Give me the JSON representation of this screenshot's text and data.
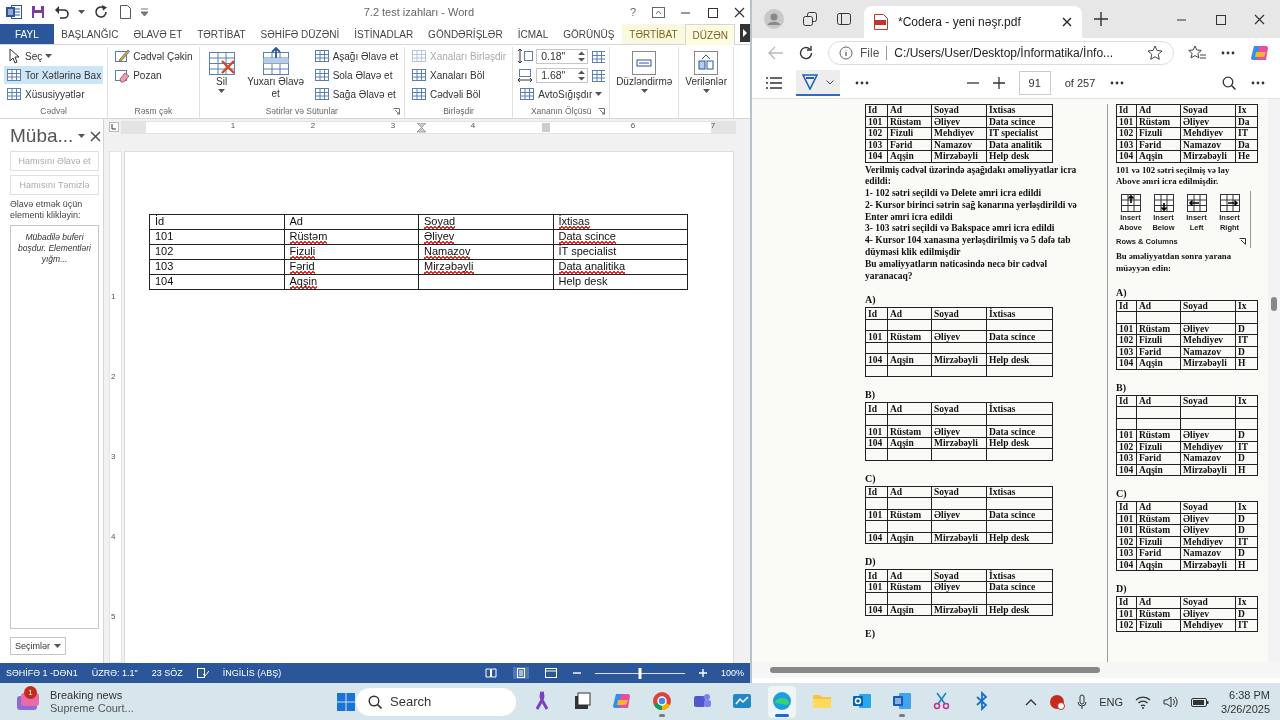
{
  "word": {
    "title": "7.2 test izahları - Word",
    "help": "?",
    "tabs": [
      {
        "label": "FAYL",
        "kind": "file",
        "selected": false
      },
      {
        "label": "BAŞLANĞIC",
        "kind": "normal",
        "selected": false
      },
      {
        "label": "ƏLAVƏ ET",
        "kind": "normal",
        "selected": false
      },
      {
        "label": "TƏRTİBAT",
        "kind": "normal",
        "selected": false
      },
      {
        "label": "SƏHİFƏ DÜZƏNİ",
        "kind": "normal",
        "selected": false
      },
      {
        "label": "İSTİNADLAR",
        "kind": "normal",
        "selected": false
      },
      {
        "label": "GÖNDƏRİŞLƏR",
        "kind": "normal",
        "selected": false
      },
      {
        "label": "İCMAL",
        "kind": "normal",
        "selected": false
      },
      {
        "label": "GÖRÜNÜŞ",
        "kind": "normal",
        "selected": false
      },
      {
        "label": "TƏRTİBAT",
        "kind": "context",
        "selected": false
      },
      {
        "label": "DÜZƏN",
        "kind": "context",
        "selected": true
      }
    ],
    "ribbon_groups": [
      {
        "label": "Cədvəl",
        "launcher": false,
        "items": [
          {
            "kind": "small",
            "label": "Seç",
            "dropdown": true,
            "on": false,
            "disabled": false
          },
          {
            "kind": "small",
            "label": "Tor Xətlərinə Bax",
            "dropdown": false,
            "on": true,
            "disabled": false
          },
          {
            "kind": "small",
            "label": "Xüsusiyyətlər",
            "dropdown": false,
            "on": false,
            "disabled": false
          }
        ]
      },
      {
        "label": "Rəsm çək",
        "launcher": false,
        "items": [
          {
            "kind": "small",
            "label": "Cədvəl Çəkin",
            "dropdown": false,
            "on": false,
            "disabled": false
          },
          {
            "kind": "small",
            "label": "Pozan",
            "dropdown": false,
            "on": false,
            "disabled": false
          }
        ]
      },
      {
        "label": "Sətirlər və Sütunlar",
        "launcher": true,
        "items": [
          {
            "kind": "large",
            "label": "Sil",
            "dropdown": true,
            "on": false,
            "disabled": false
          },
          {
            "kind": "large",
            "label": "Yuxarı Əlavə et",
            "dropdown": false,
            "on": false,
            "disabled": false
          },
          {
            "kind": "small",
            "label": "Aşağı Əlavə et",
            "dropdown": false,
            "on": false,
            "disabled": false
          },
          {
            "kind": "small",
            "label": "Sola Əlavə et",
            "dropdown": false,
            "on": false,
            "disabled": false
          },
          {
            "kind": "small",
            "label": "Sağa Əlavə et",
            "dropdown": false,
            "on": false,
            "disabled": false
          }
        ]
      },
      {
        "label": "Birləşdir",
        "launcher": false,
        "items": [
          {
            "kind": "small",
            "label": "Xanaları Birləşdir",
            "dropdown": false,
            "on": false,
            "disabled": true
          },
          {
            "kind": "small",
            "label": "Xanaları Böl",
            "dropdown": false,
            "on": false,
            "disabled": false
          },
          {
            "kind": "small",
            "label": "Cədvəli Böl",
            "dropdown": false,
            "on": false,
            "disabled": false
          }
        ]
      },
      {
        "label": "Xananın Ölçüsü",
        "launcher": true,
        "items": [
          {
            "kind": "spinner",
            "value": "0.18\""
          },
          {
            "kind": "spinner",
            "value": "1.68\""
          },
          {
            "kind": "small",
            "label": "AvtoSığışdır",
            "dropdown": true,
            "on": false,
            "disabled": false
          }
        ]
      },
      {
        "items": [
          {
            "kind": "large",
            "label": "Düzləndirmə",
            "dropdown": true,
            "on": false,
            "disabled": false
          }
        ]
      },
      {
        "items": [
          {
            "kind": "large",
            "label": "Verilənlər",
            "dropdown": true,
            "on": false,
            "disabled": false
          }
        ]
      }
    ],
    "clipboard_pane": {
      "title": "Müba...",
      "buttons": [
        {
          "label": "Hamısını Əlavə et",
          "disabled": true
        },
        {
          "label": "Hamısını Təmizlə",
          "disabled": true
        }
      ],
      "hint": "Əlavə etmək üçün elementi klikləyin:",
      "empty_message": "Mübadilə buferi boşdur. Elementləri yığm...",
      "options_button": "Seçimlər"
    },
    "ruler": {
      "numbers": [
        "1",
        "2",
        "3",
        "4",
        "6",
        "7"
      ]
    },
    "vertical_ruler": {
      "numbers": [
        "1",
        "2",
        "3",
        "4",
        "5"
      ]
    },
    "document_table": {
      "columns": [
        {
          "text": "İd",
          "misspelled": false
        },
        {
          "text": "Ad",
          "misspelled": false
        },
        {
          "text": "Soyad",
          "misspelled": true
        },
        {
          "text": "İxtisas",
          "misspelled": true
        }
      ],
      "rows": [
        {
          "cells": [
            {
              "text": "101",
              "misspelled": false
            },
            {
              "text": "Rüstəm",
              "misspelled": true
            },
            {
              "text": "Əliyev",
              "misspelled": true
            },
            {
              "text": "Data scince",
              "misspelled": true
            }
          ]
        },
        {
          "cells": [
            {
              "text": "102",
              "misspelled": false
            },
            {
              "text": "Fizuli",
              "misspelled": true
            },
            {
              "text": "Namazov",
              "misspelled": true
            },
            {
              "text": "İT specialist",
              "misspelled": false
            }
          ]
        },
        {
          "cells": [
            {
              "text": "103",
              "misspelled": false
            },
            {
              "text": "Fərid",
              "misspelled": true
            },
            {
              "text": "Mirzəbəyli",
              "misspelled": true
            },
            {
              "text": "Data analitika",
              "misspelled": true
            }
          ]
        },
        {
          "cells": [
            {
              "text": "104",
              "misspelled": false
            },
            {
              "text": "Aqşin",
              "misspelled": true
            },
            {
              "misspelled": false
            },
            {
              "text": "Help desk",
              "misspelled": false
            }
          ]
        }
      ]
    },
    "status_bar": {
      "page": "SƏHİFƏ 1 -DƏN1",
      "position": "ÜZRƏ: 1.1\"",
      "words": "23 SÖZ",
      "language": "İNGİLİS (ABŞ)",
      "zoom": "100%",
      "zoom_slider": {
        "level": 0.5
      }
    }
  },
  "edge": {
    "tabs": [
      {
        "title": "*Codera - yeni nəşr.pdf",
        "selected": true
      }
    ],
    "address": {
      "scheme": "File",
      "url": "C:/Users/User/Desktop/İnformatika/İnfo..."
    },
    "pdf_toolbar": {
      "draw_selected": true,
      "page": "91",
      "page_total": "of 257"
    },
    "pdf_page": {
      "columns": [
        {
          "blocks": [
            {
              "kind": "table",
              "rows": [
                {
                  "kind": "data",
                  "cells": [
                    "Id",
                    "Ad",
                    "Soyad",
                    "İxtisas"
                  ]
                },
                {
                  "kind": "data",
                  "cells": [
                    "101",
                    "Rüstəm",
                    "Əliyev",
                    "Data scince"
                  ]
                },
                {
                  "kind": "data",
                  "cells": [
                    "102",
                    "Fizuli",
                    "Mehdiyev",
                    "IT specialist"
                  ]
                },
                {
                  "kind": "data",
                  "cells": [
                    "103",
                    "Fərid",
                    "Namazov",
                    "Data analitik"
                  ]
                },
                {
                  "kind": "data",
                  "cells": [
                    "104",
                    "Aqşin",
                    "Mirzəbəyli",
                    "Help desk"
                  ]
                }
              ]
            },
            {
              "kind": "text",
              "lines": [
                "Verilmiş cədvəl üzərində aşağıdakı əməliyyatlar icra",
                "edildi:",
                "1- 102 sətri seçildi və Delete əmri icra edildi",
                "2- Kursor birinci sətrin sağ kənarına yerləşdirildi və",
                "Enter əmri icra edildi",
                "3- 103 sətri seçildi və Bakspace əmri icra edildi",
                "4- Kursor 104 xanasına yerləşdirilmiş və 5 dəfə tab",
                "düyməsi klik edilmişdir",
                "Bu əməliyyatların nəticəsində necə bir cədvəl",
                "yaranacaq?"
              ]
            },
            {
              "kind": "label",
              "text": "A)"
            },
            {
              "kind": "table",
              "rows": [
                {
                  "kind": "data",
                  "cells": [
                    "Id",
                    "Ad",
                    "Soyad",
                    "İxtisas"
                  ]
                },
                {
                  "kind": "empty"
                },
                {
                  "kind": "data",
                  "cells": [
                    "101",
                    "Rüstəm",
                    "Əliyev",
                    "Data scince"
                  ]
                },
                {
                  "kind": "empty"
                },
                {
                  "kind": "data",
                  "cells": [
                    "104",
                    "Aqşin",
                    "Mirzəbəyli",
                    "Help desk"
                  ]
                },
                {
                  "kind": "empty"
                }
              ]
            },
            {
              "kind": "label",
              "text": "B)"
            },
            {
              "kind": "table",
              "rows": [
                {
                  "kind": "data",
                  "cells": [
                    "Id",
                    "Ad",
                    "Soyad",
                    "İxtisas"
                  ]
                },
                {
                  "kind": "empty"
                },
                {
                  "kind": "data",
                  "cells": [
                    "101",
                    "Rüstəm",
                    "Əliyev",
                    "Data scince"
                  ]
                },
                {
                  "kind": "data",
                  "cells": [
                    "104",
                    "Aqşin",
                    "Mirzəbəyli",
                    "Help desk"
                  ]
                },
                {
                  "kind": "empty"
                }
              ]
            },
            {
              "kind": "label",
              "text": "C)"
            },
            {
              "kind": "table",
              "rows": [
                {
                  "kind": "data",
                  "cells": [
                    "Id",
                    "Ad",
                    "Soyad",
                    "İxtisas"
                  ]
                },
                {
                  "kind": "empty"
                },
                {
                  "kind": "data",
                  "cells": [
                    "101",
                    "Rüstəm",
                    "Əliyev",
                    "Data scince"
                  ]
                },
                {
                  "kind": "empty"
                },
                {
                  "kind": "data",
                  "cells": [
                    "104",
                    "Aqşin",
                    "Mirzəbəyli",
                    "Help desk"
                  ]
                }
              ]
            },
            {
              "kind": "label",
              "text": "D)"
            },
            {
              "kind": "table",
              "rows": [
                {
                  "kind": "data",
                  "cells": [
                    "Id",
                    "Ad",
                    "Soyad",
                    "İxtisas"
                  ]
                },
                {
                  "kind": "data",
                  "cells": [
                    "101",
                    "Rüstəm",
                    "Əliyev",
                    "Data scince"
                  ]
                },
                {
                  "kind": "empty"
                },
                {
                  "kind": "data",
                  "cells": [
                    "104",
                    "Aqşin",
                    "Mirzəbəyli",
                    "Help desk"
                  ]
                }
              ]
            },
            {
              "kind": "label",
              "text": "E)"
            }
          ]
        },
        {
          "blocks": [
            {
              "kind": "table",
              "rows": [
                {
                  "kind": "data",
                  "cells": [
                    "Id",
                    "Ad",
                    "Soyad",
                    "Ix"
                  ]
                },
                {
                  "kind": "data",
                  "cells": [
                    "101",
                    "Rüstəm",
                    "Əliyev",
                    "Da"
                  ]
                },
                {
                  "kind": "data",
                  "cells": [
                    "102",
                    "Fizuli",
                    "Mehdiyev",
                    "IT"
                  ]
                },
                {
                  "kind": "data",
                  "cells": [
                    "103",
                    "Fərid",
                    "Namazov",
                    "Da"
                  ]
                },
                {
                  "kind": "data",
                  "cells": [
                    "104",
                    "Aqşin",
                    "Mirzəbəyli",
                    "He"
                  ]
                }
              ]
            },
            {
              "kind": "text",
              "lines": [
                "101 və 102 sətri seçilmiş və lay",
                "Above əmri icra edilmişdir."
              ]
            },
            {
              "kind": "ribbon",
              "buttons": [
                "Insert Above",
                "Insert Below",
                "Insert Left",
                "Insert Right"
              ],
              "caption": "Rows & Columns"
            },
            {
              "kind": "text",
              "lines": [
                "Bu əməliyyatdan sonra yarana",
                "müəyyən edin:"
              ]
            },
            {
              "kind": "label",
              "text": "A)"
            },
            {
              "kind": "table",
              "rows": [
                {
                  "kind": "data",
                  "cells": [
                    "Id",
                    "Ad",
                    "Soyad",
                    "Ix"
                  ]
                },
                {
                  "kind": "empty"
                },
                {
                  "kind": "data",
                  "cells": [
                    "101",
                    "Rüstəm",
                    "Əliyev",
                    "D"
                  ]
                },
                {
                  "kind": "data",
                  "cells": [
                    "102",
                    "Fizuli",
                    "Mehdiyev",
                    "IT"
                  ]
                },
                {
                  "kind": "data",
                  "cells": [
                    "103",
                    "Fərid",
                    "Namazov",
                    "D"
                  ]
                },
                {
                  "kind": "data",
                  "cells": [
                    "104",
                    "Aqşin",
                    "Mirzəbəyli",
                    "H"
                  ]
                }
              ]
            },
            {
              "kind": "label",
              "text": "B)"
            },
            {
              "kind": "table",
              "rows": [
                {
                  "kind": "data",
                  "cells": [
                    "Id",
                    "Ad",
                    "Soyad",
                    "Ix"
                  ]
                },
                {
                  "kind": "empty"
                },
                {
                  "kind": "empty"
                },
                {
                  "kind": "data",
                  "cells": [
                    "101",
                    "Rüstəm",
                    "Əliyev",
                    "D"
                  ]
                },
                {
                  "kind": "data",
                  "cells": [
                    "102",
                    "Fizuli",
                    "Mehdiyev",
                    "IT"
                  ]
                },
                {
                  "kind": "data",
                  "cells": [
                    "103",
                    "Fərid",
                    "Namazov",
                    "D"
                  ]
                },
                {
                  "kind": "data",
                  "cells": [
                    "104",
                    "Aqşin",
                    "Mirzəbəyli",
                    "H"
                  ]
                }
              ]
            },
            {
              "kind": "label",
              "text": "C)"
            },
            {
              "kind": "table",
              "rows": [
                {
                  "kind": "data",
                  "cells": [
                    "Id",
                    "Ad",
                    "Soyad",
                    "Ix"
                  ]
                },
                {
                  "kind": "data",
                  "cells": [
                    "101",
                    "Rüstəm",
                    "Əliyev",
                    "D"
                  ]
                },
                {
                  "kind": "data",
                  "cells": [
                    "101",
                    "Rüstəm",
                    "Əliyev",
                    "D"
                  ]
                },
                {
                  "kind": "data",
                  "cells": [
                    "102",
                    "Fizuli",
                    "Mehdiyev",
                    "IT"
                  ]
                },
                {
                  "kind": "data",
                  "cells": [
                    "103",
                    "Fərid",
                    "Namazov",
                    "D"
                  ]
                },
                {
                  "kind": "data",
                  "cells": [
                    "104",
                    "Aqşin",
                    "Mirzəbəyli",
                    "H"
                  ]
                }
              ]
            },
            {
              "kind": "label",
              "text": "D)"
            },
            {
              "kind": "table",
              "rows": [
                {
                  "kind": "data",
                  "cells": [
                    "Id",
                    "Ad",
                    "Soyad",
                    "Ix"
                  ]
                },
                {
                  "kind": "data",
                  "cells": [
                    "101",
                    "Rüstəm",
                    "Əliyev",
                    "D"
                  ]
                },
                {
                  "kind": "data",
                  "cells": [
                    "102",
                    "Fizuli",
                    "Mehdiyev",
                    "IT"
                  ]
                }
              ]
            }
          ]
        }
      ]
    }
  },
  "taskbar": {
    "news": {
      "badge": "1",
      "headline": "Breaking news",
      "subtitle": "Supreme Court..."
    },
    "search": {
      "placeholder": "Search"
    },
    "apps": [
      {
        "running": false,
        "active": false
      },
      {
        "running": false,
        "active": false
      },
      {
        "running": false,
        "active": false
      },
      {
        "running": true,
        "active": false
      },
      {
        "running": false,
        "active": false
      },
      {
        "running": false,
        "active": false
      },
      {
        "running": true,
        "active": true
      },
      {
        "running": false,
        "active": false
      },
      {
        "running": false,
        "active": false
      },
      {
        "running": true,
        "active": false
      },
      {
        "running": false,
        "active": false
      },
      {
        "running": false,
        "active": false
      }
    ],
    "tray": {
      "language": "ENG",
      "time": "6:38 PM",
      "date": "3/26/2025"
    }
  }
}
